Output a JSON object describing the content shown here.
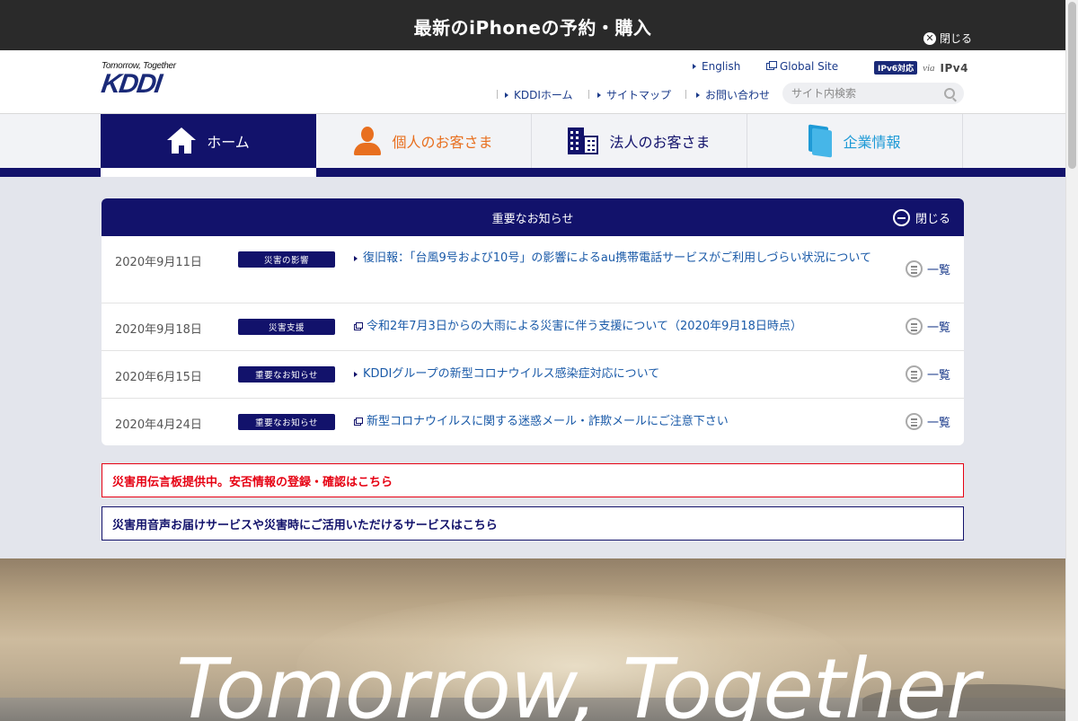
{
  "promo": {
    "text": "最新のiPhoneの予約・購入",
    "close_label": "閉じる"
  },
  "header": {
    "logo_tagline": "Tomorrow, Together",
    "logo_text": "KDDI",
    "links_top": [
      {
        "label": "English",
        "icon": "arrow-icon"
      },
      {
        "label": "Global Site",
        "icon": "external-link-icon"
      }
    ],
    "ipv6": {
      "badge": "IPv6対応",
      "via": "via",
      "v4": "IPv4"
    },
    "links_bottom": [
      {
        "label": "KDDIホーム"
      },
      {
        "label": "サイトマップ"
      },
      {
        "label": "お問い合わせ"
      }
    ],
    "search_placeholder": "サイト内検索"
  },
  "nav": {
    "items": [
      {
        "label": "ホーム",
        "icon": "home-icon",
        "active": true
      },
      {
        "label": "個人のお客さま",
        "icon": "person-icon",
        "color": "#e86f1f"
      },
      {
        "label": "法人のお客さま",
        "icon": "building-icon",
        "color": "#12126b"
      },
      {
        "label": "企業情報",
        "icon": "book-icon",
        "color": "#1e9ad6"
      }
    ]
  },
  "notice": {
    "title": "重要なお知らせ",
    "close_label": "閉じる",
    "rows": [
      {
        "date": "2020年9月11日",
        "tag": "災害の影響",
        "text": "復旧報：「台風9号および10号」の影響によるau携帯電話サービスがご利用しづらい状況について",
        "link_icon": "arrow-icon",
        "list_label": "一覧"
      },
      {
        "date": "2020年9月18日",
        "tag": "災害支援",
        "text": "令和2年7月3日からの大雨による災害に伴う支援について（2020年9月18日時点）",
        "link_icon": "external-link-icon",
        "list_label": "一覧"
      },
      {
        "date": "2020年6月15日",
        "tag": "重要なお知らせ",
        "text": "KDDIグループの新型コロナウイルス感染症対応について",
        "link_icon": "arrow-icon",
        "list_label": "一覧"
      },
      {
        "date": "2020年4月24日",
        "tag": "重要なお知らせ",
        "text": "新型コロナウイルスに関する迷惑メール・詐欺メールにご注意下さい",
        "link_icon": "external-link-icon",
        "list_label": "一覧"
      }
    ]
  },
  "disaster": {
    "red_text": "災害用伝言板提供中。安否情報の登録・確認はこちら",
    "blue_text": "災害用音声お届けサービスや災害時にご活用いただけるサービスはこちら"
  },
  "hero": {
    "text": "Tomorrow, Together"
  },
  "colors": {
    "brand_navy": "#12126b",
    "personal_orange": "#e86f1f",
    "company_blue": "#1e9ad6",
    "alert_red": "#e60012"
  }
}
